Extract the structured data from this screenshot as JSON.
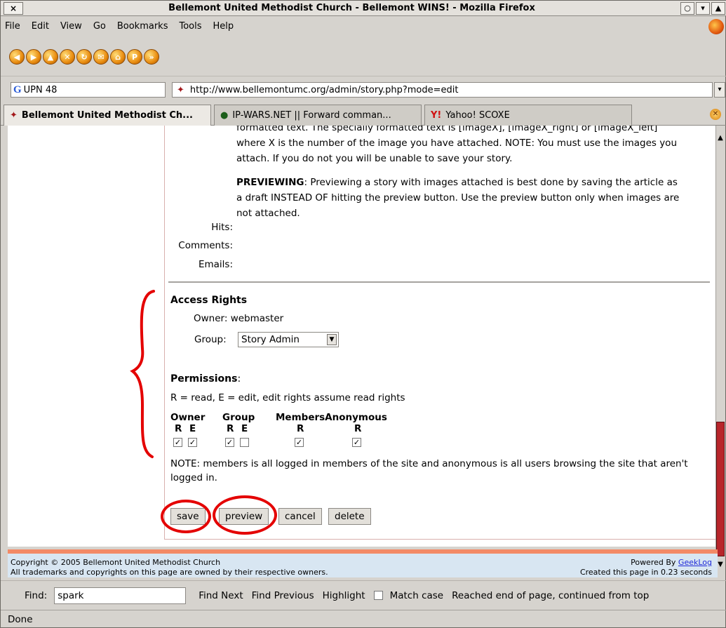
{
  "window": {
    "title": "Bellemont United Methodist Church - Bellemont WINS! - Mozilla Firefox",
    "close_glyph": "×"
  },
  "menu": {
    "file": "File",
    "edit": "Edit",
    "view": "View",
    "go": "Go",
    "bookmarks": "Bookmarks",
    "tools": "Tools",
    "help": "Help"
  },
  "toolbar_icons": [
    "back-icon",
    "forward-icon",
    "up-icon",
    "stop-icon",
    "reload-icon",
    "mail-icon",
    "home-icon",
    "p-icon",
    "go-icon"
  ],
  "search": {
    "value": "UPN 48"
  },
  "address": {
    "url": "http://www.bellemontumc.org/admin/story.php?mode=edit"
  },
  "tabs": [
    {
      "label": "Bellemont United Methodist Ch..."
    },
    {
      "label": "IP-WARS.NET || Forward comman..."
    },
    {
      "label": "Yahoo! SCOXE"
    }
  ],
  "help": {
    "line1": "formatted text. The specially formatted text is [imageX], [imageX_right] or [imageX_left]",
    "line2": "where X is the number of the image you have attached. NOTE: You must use the images you",
    "line3": "attach. If you do not you will be unable to save your story.",
    "preview_title": "PREVIEWING",
    "preview_line1": ": Previewing a story with images attached is best done by saving the article as",
    "preview_line2": "a draft INSTEAD OF hitting the preview button. Use the preview button only when images are",
    "preview_line3": "not attached."
  },
  "fields": {
    "hits": "Hits:",
    "comments": "Comments:",
    "emails": "Emails:"
  },
  "access": {
    "title": "Access Rights",
    "owner_label": "Owner:",
    "owner_value": "webmaster",
    "group_label": "Group:",
    "group_value": "Story Admin"
  },
  "permissions": {
    "title": "Permissions",
    "legend": "R = read, E = edit, edit rights assume read rights",
    "headers": [
      "Owner",
      "Group",
      "MembersAnonymous"
    ],
    "sub": {
      "owner_r": "R",
      "owner_e": "E",
      "group_r": "R",
      "group_e": "E",
      "members_r": "R",
      "anon_r": "R"
    },
    "checked": {
      "owner_r": true,
      "owner_e": true,
      "group_r": true,
      "group_e": false,
      "members_r": true,
      "anon_r": true
    },
    "note": "NOTE: members is all logged in members of the site and anonymous is all users browsing the site that aren't logged in."
  },
  "buttons": {
    "save": "save",
    "preview": "preview",
    "cancel": "cancel",
    "delete": "delete"
  },
  "footer": {
    "copyright": "Copyright © 2005 Bellemont United Methodist Church",
    "trademarks": "All trademarks and copyrights on this page are owned by their respective owners.",
    "powered_prefix": "Powered By ",
    "powered_link": "GeekLog",
    "created": "Created this page in 0.23 seconds"
  },
  "findbar": {
    "label": "Find:",
    "value": "spark",
    "next": "Find Next",
    "previous": "Find Previous",
    "highlight": "Highlight",
    "match_case": "Match case",
    "status": "Reached end of page, continued from top"
  },
  "status": {
    "text": "Done"
  },
  "colors": {
    "annotation": "#e40000",
    "scroll_thumb": "#b8262b",
    "footer_bg": "#d8e6f2"
  }
}
